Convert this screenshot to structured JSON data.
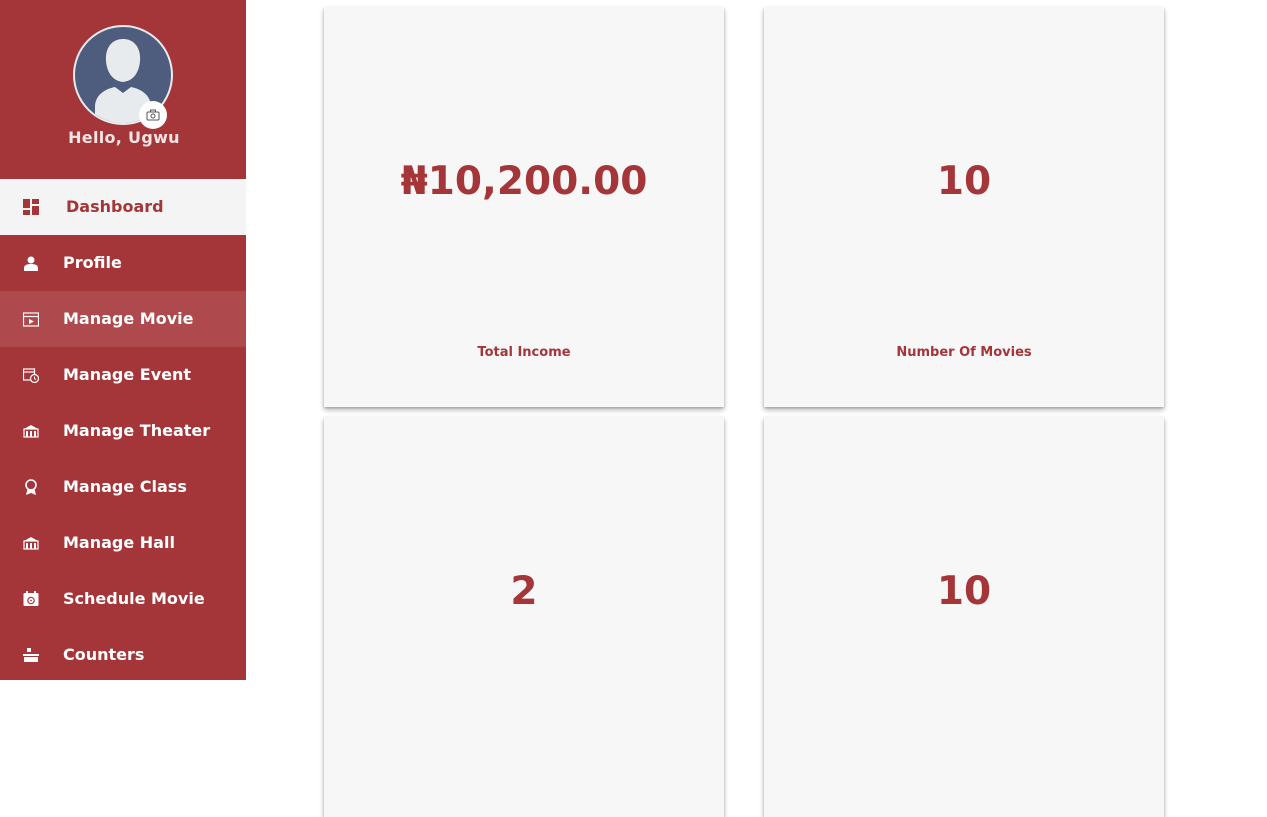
{
  "user": {
    "greeting": "Hello, Ugwu"
  },
  "sidebar": {
    "items": [
      {
        "label": "Dashboard",
        "icon": "dashboard-icon"
      },
      {
        "label": "Profile",
        "icon": "user-icon"
      },
      {
        "label": "Manage Movie",
        "icon": "movie-clapper-icon"
      },
      {
        "label": "Manage Event",
        "icon": "calendar-clock-icon"
      },
      {
        "label": "Manage Theater",
        "icon": "theater-building-icon"
      },
      {
        "label": "Manage Class",
        "icon": "award-ribbon-icon"
      },
      {
        "label": "Manage Hall",
        "icon": "hall-building-icon"
      },
      {
        "label": "Schedule Movie",
        "icon": "calendar-film-icon"
      },
      {
        "label": "Counters",
        "icon": "counter-desk-icon"
      }
    ]
  },
  "cards": [
    {
      "value": "₦10,200.00",
      "label": "Total Income"
    },
    {
      "value": "10",
      "label": "Number Of Movies"
    },
    {
      "value": "2"
    },
    {
      "value": "10"
    }
  ],
  "colors": {
    "brand": "#a4363a",
    "active_bg": "#f4f4f4",
    "hover_bg": "#ae4a4e",
    "card_bg": "#f7f7f7",
    "avatar_bg": "#4e5d7e"
  }
}
